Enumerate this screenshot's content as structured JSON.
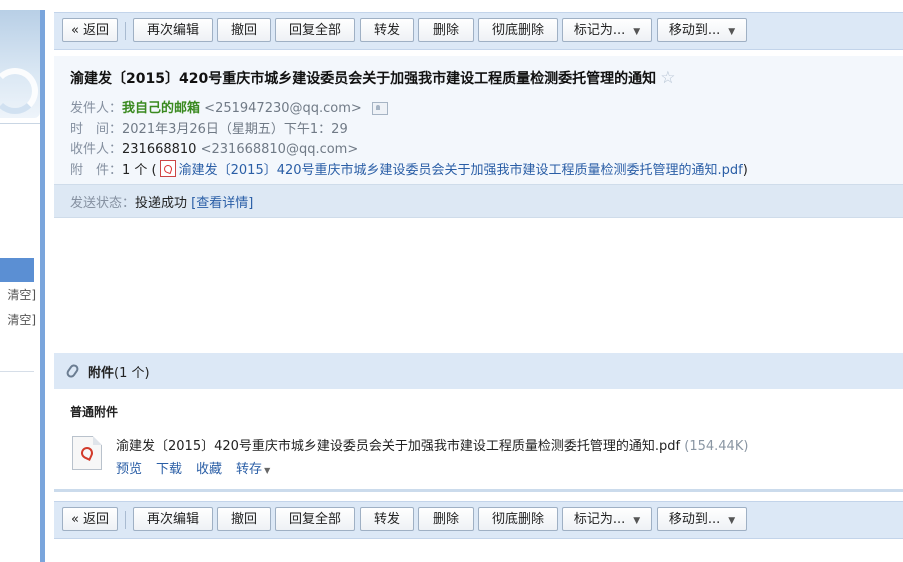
{
  "toolbar": {
    "back": "« 返回",
    "edit_again": "再次编辑",
    "recall": "撤回",
    "reply_all": "回复全部",
    "forward": "转发",
    "delete": "删除",
    "delete_permanently": "彻底删除",
    "mark_as": "标记为...",
    "move_to": "移动到..."
  },
  "mail": {
    "subject": "渝建发〔2015〕420号重庆市城乡建设委员会关于加强我市建设工程质量检测委托管理的通知",
    "star_glyph": "☆",
    "from_label": "发件人：",
    "from_name": "我自己的邮箱",
    "from_address": "<251947230@qq.com>",
    "time_label": "时　间：",
    "time_value": "2021年3月26日（星期五）下午1：29",
    "to_label": "收件人：",
    "to_name": "231668810",
    "to_address": "<231668810@qq.com>",
    "attach_label": "附　件：",
    "attach_count": "1 个 (",
    "attach_file": "渝建发〔2015〕420号重庆市城乡建设委员会关于加强我市建设工程质量检测委托管理的通知.pdf",
    "attach_close": ")"
  },
  "send_status": {
    "label": "发送状态：",
    "value": "投递成功",
    "details": "[查看详情]"
  },
  "attachments": {
    "title": "附件",
    "count": "(1 个)",
    "group_title": "普通附件",
    "items": [
      {
        "name": "渝建发〔2015〕420号重庆市城乡建设委员会关于加强我市建设工程质量检测委托管理的通知.pdf",
        "size": "(154.44K)",
        "preview": "预览",
        "download": "下载",
        "favorite": "收藏",
        "save_to": "转存"
      }
    ]
  },
  "sidebar": {
    "clear_1": "清空]",
    "clear_2": "清空]"
  },
  "colors": {
    "toolbar_bg": "#dce8f6",
    "header_bg": "#f3f7fc",
    "link": "#2a5ea6",
    "sender_green": "#3a8a20",
    "sidebar_active": "#5b8fd3"
  }
}
